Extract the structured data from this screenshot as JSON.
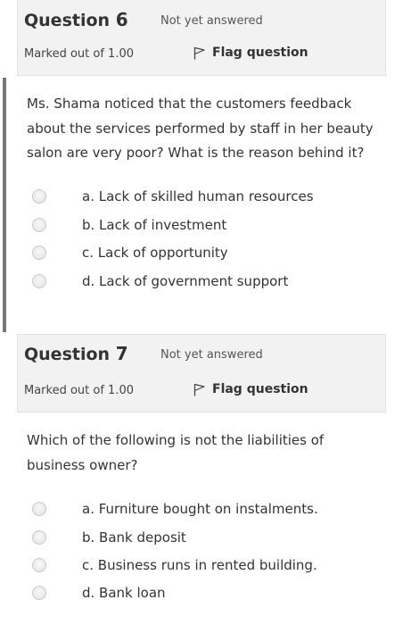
{
  "questions": [
    {
      "title_prefix": "Question",
      "number": "6",
      "state": "Not yet answered",
      "marked": "Marked out of 1.00",
      "flag_label": "Flag question",
      "text": "Ms. Shama noticed that the customers feedback about the services performed by staff in her beauty salon are very poor? What is the reason behind it?",
      "options": [
        "a. Lack of skilled human resources",
        "b. Lack of investment",
        "c. Lack of opportunity",
        "d. Lack of government support"
      ]
    },
    {
      "title_prefix": "Question",
      "number": "7",
      "state": "Not yet answered",
      "marked": "Marked out of 1.00",
      "flag_label": "Flag question",
      "text": "Which of the following is not the liabilities of business owner?",
      "options": [
        "a. Furniture bought on instalments.",
        "b. Bank deposit",
        "c. Business runs in rented building.",
        "d. Bank loan"
      ]
    }
  ],
  "colors": {
    "info_bg": "#f2f2f2",
    "info_border": "#e1e1e1",
    "text": "#333333",
    "current_question_bar": "#777777"
  },
  "icons": {
    "flag": "flag-icon",
    "radio": "radio-unchecked"
  }
}
